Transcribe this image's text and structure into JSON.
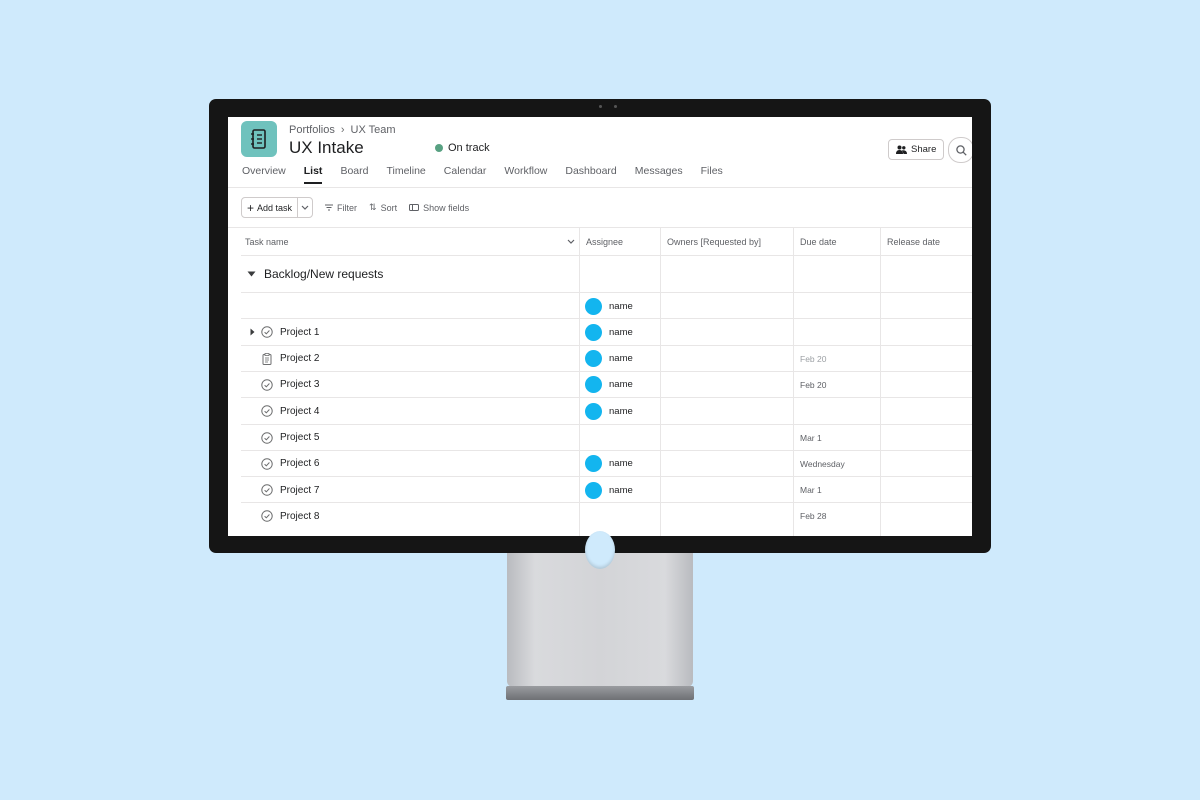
{
  "breadcrumb": {
    "parent": "Portfolios",
    "separator": "›",
    "current": "UX Team"
  },
  "project": {
    "title": "UX Intake",
    "status": "On track",
    "status_color": "#58a182",
    "icon_color": "#6fc2bd"
  },
  "header": {
    "share_label": "Share"
  },
  "tabs": [
    {
      "label": "Overview"
    },
    {
      "label": "List"
    },
    {
      "label": "Board"
    },
    {
      "label": "Timeline"
    },
    {
      "label": "Calendar"
    },
    {
      "label": "Workflow"
    },
    {
      "label": "Dashboard"
    },
    {
      "label": "Messages"
    },
    {
      "label": "Files"
    }
  ],
  "active_tab": "List",
  "toolbar": {
    "add_task": "Add task",
    "filter": "Filter",
    "sort": "Sort",
    "show_fields": "Show fields"
  },
  "columns": {
    "task_name": "Task name",
    "assignee": "Assignee",
    "owners": "Owners [Requested by]",
    "due_date": "Due date",
    "release_date": "Release date"
  },
  "section": {
    "title": "Backlog/New requests"
  },
  "rows": [
    {
      "name": "",
      "assignee": "name",
      "due": ""
    },
    {
      "name": "Project 1",
      "assignee": "name",
      "due": ""
    },
    {
      "name": "Project 2",
      "assignee": "name",
      "due": "Feb 20"
    },
    {
      "name": "Project 3",
      "assignee": "name",
      "due": "Feb 20"
    },
    {
      "name": "Project 4",
      "assignee": "name",
      "due": ""
    },
    {
      "name": "Project 5",
      "assignee": "",
      "due": "Mar 1"
    },
    {
      "name": "Project 6",
      "assignee": "name",
      "due": "Wednesday"
    },
    {
      "name": "Project 7",
      "assignee": "name",
      "due": "Mar 1"
    },
    {
      "name": "Project 8",
      "assignee": "",
      "due": "Feb 28"
    }
  ],
  "colors": {
    "background": "#cfeafc",
    "avatar": "#13b5ef"
  }
}
